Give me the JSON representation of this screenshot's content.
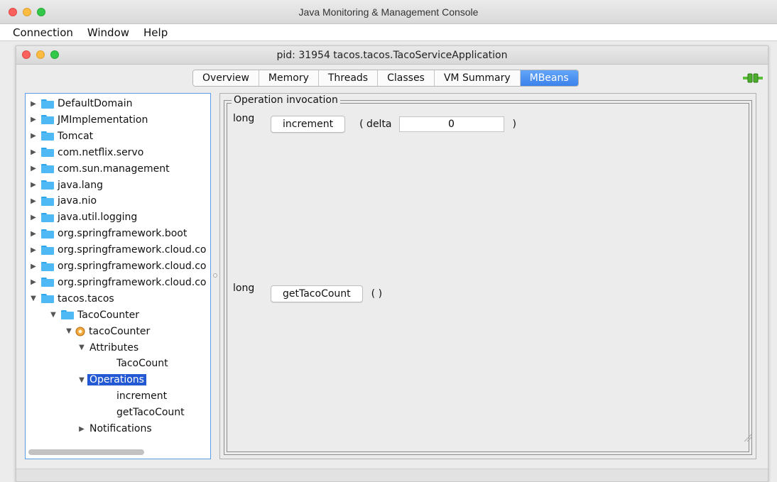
{
  "app": {
    "title": "Java Monitoring & Management Console"
  },
  "menu": [
    "Connection",
    "Window",
    "Help"
  ],
  "inner_window": {
    "title": "pid: 31954 tacos.tacos.TacoServiceApplication"
  },
  "tabs": [
    {
      "label": "Overview",
      "active": false
    },
    {
      "label": "Memory",
      "active": false
    },
    {
      "label": "Threads",
      "active": false
    },
    {
      "label": "Classes",
      "active": false
    },
    {
      "label": "VM Summary",
      "active": false
    },
    {
      "label": "MBeans",
      "active": true
    }
  ],
  "tree": [
    {
      "label": "DefaultDomain",
      "depth": 0,
      "expanded": false,
      "icon": "folder-icon"
    },
    {
      "label": "JMImplementation",
      "depth": 0,
      "expanded": false,
      "icon": "folder-icon"
    },
    {
      "label": "Tomcat",
      "depth": 0,
      "expanded": false,
      "icon": "folder-icon"
    },
    {
      "label": "com.netflix.servo",
      "depth": 0,
      "expanded": false,
      "icon": "folder-icon"
    },
    {
      "label": "com.sun.management",
      "depth": 0,
      "expanded": false,
      "icon": "folder-icon"
    },
    {
      "label": "java.lang",
      "depth": 0,
      "expanded": false,
      "icon": "folder-icon"
    },
    {
      "label": "java.nio",
      "depth": 0,
      "expanded": false,
      "icon": "folder-icon"
    },
    {
      "label": "java.util.logging",
      "depth": 0,
      "expanded": false,
      "icon": "folder-icon"
    },
    {
      "label": "org.springframework.boot",
      "depth": 0,
      "expanded": false,
      "icon": "folder-icon"
    },
    {
      "label": "org.springframework.cloud.co",
      "depth": 0,
      "expanded": false,
      "icon": "folder-icon"
    },
    {
      "label": "org.springframework.cloud.co",
      "depth": 0,
      "expanded": false,
      "icon": "folder-icon"
    },
    {
      "label": "org.springframework.cloud.co",
      "depth": 0,
      "expanded": false,
      "icon": "folder-icon"
    },
    {
      "label": "tacos.tacos",
      "depth": 0,
      "expanded": true,
      "icon": "folder-icon"
    },
    {
      "label": "TacoCounter",
      "depth": 1,
      "expanded": true,
      "icon": "folder-icon"
    },
    {
      "label": "tacoCounter",
      "depth": 2,
      "expanded": true,
      "icon": "bean-icon"
    },
    {
      "label": "Attributes",
      "depth": 3,
      "expanded": true,
      "icon": ""
    },
    {
      "label": "TacoCount",
      "depth": 4,
      "expanded": null,
      "icon": ""
    },
    {
      "label": "Operations",
      "depth": 3,
      "expanded": true,
      "icon": "",
      "selected": true
    },
    {
      "label": "increment",
      "depth": 4,
      "expanded": null,
      "icon": ""
    },
    {
      "label": "getTacoCount",
      "depth": 4,
      "expanded": null,
      "icon": ""
    },
    {
      "label": "Notifications",
      "depth": 3,
      "expanded": false,
      "icon": ""
    }
  ],
  "operation_panel": {
    "legend": "Operation invocation",
    "operations": [
      {
        "return_type": "long",
        "name": "increment",
        "param_open": "( delta",
        "param_value": "0",
        "param_close": ")"
      },
      {
        "return_type": "long",
        "name": "getTacoCount",
        "params": "( )"
      }
    ]
  },
  "colors": {
    "accent": "#3b82ec",
    "selection": "#2359d3",
    "folder": "#4fb9f5"
  }
}
